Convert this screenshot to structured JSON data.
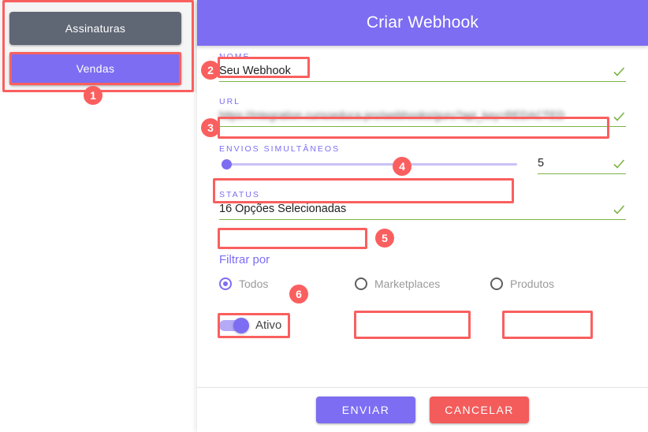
{
  "left_panel": {
    "buttons": [
      {
        "label": "Assinaturas",
        "color": "#5f6674",
        "active": false
      },
      {
        "label": "Vendas",
        "color": "#7c6df2",
        "active": true
      }
    ]
  },
  "dialog": {
    "title": "Criar Webhook",
    "header_color": "#7c6df2",
    "fields": {
      "nome": {
        "label": "NOME",
        "value": "Seu Webhook",
        "valid": true
      },
      "url": {
        "label": "URL",
        "value": "https://integration.cursoeduca.pro/webhooks/guru?api_key=REDACTED",
        "redacted": true,
        "valid": true
      },
      "envios_simultaneos": {
        "label": "ENVIOS SIMULTÂNEOS",
        "value": "5",
        "slider_min": 1,
        "slider_max": 100,
        "slider_position_pct": 2,
        "valid": true
      },
      "status": {
        "label": "STATUS",
        "value": "16 Opções Selecionadas",
        "valid": true
      }
    },
    "filter": {
      "label": "Filtrar por",
      "options": [
        {
          "label": "Todos",
          "selected": true
        },
        {
          "label": "Marketplaces",
          "selected": false
        },
        {
          "label": "Produtos",
          "selected": false
        }
      ]
    },
    "toggle": {
      "label": "Ativo",
      "on": true
    },
    "footer": {
      "submit_label": "ENVIAR",
      "submit_color": "#7c6df2",
      "cancel_label": "CANCELAR",
      "cancel_color": "#f45b5b"
    }
  },
  "annotations": {
    "badges": [
      {
        "number": "1"
      },
      {
        "number": "2"
      },
      {
        "number": "3"
      },
      {
        "number": "4"
      },
      {
        "number": "5"
      },
      {
        "number": "6"
      }
    ],
    "color": "#fa5f5f"
  }
}
